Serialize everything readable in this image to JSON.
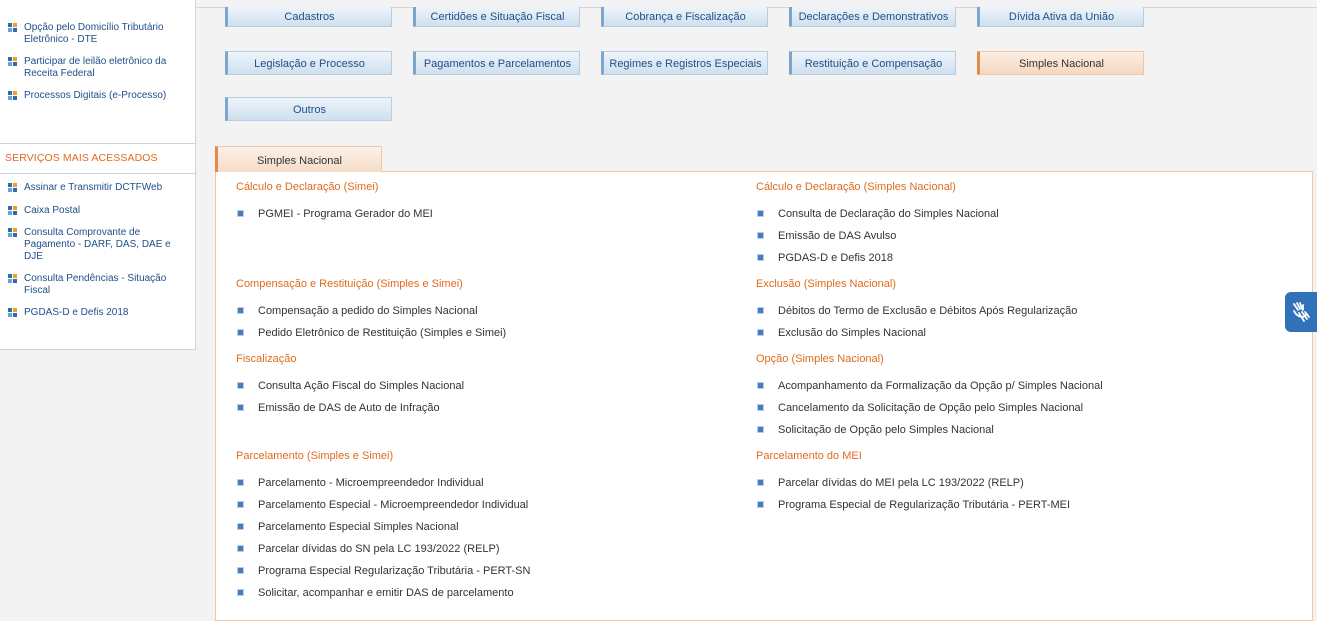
{
  "sidebar": {
    "top_items": [
      {
        "label": "Opção pelo Domicílio Tributário Eletrônico - DTE"
      },
      {
        "label": "Participar de leilão eletrônico da Receita Federal"
      },
      {
        "label": "Processos Digitais (e-Processo)"
      }
    ],
    "section_title": "SERVIÇOS MAIS ACESSADOS",
    "items": [
      {
        "label": "Assinar e Transmitir DCTFWeb"
      },
      {
        "label": "Caixa Postal"
      },
      {
        "label": "Consulta Comprovante de Pagamento - DARF, DAS, DAE e DJE"
      },
      {
        "label": "Consulta Pendências - Situação Fiscal"
      },
      {
        "label": "PGDAS-D e Defis 2018"
      }
    ]
  },
  "categories": [
    {
      "label": "Cadastros"
    },
    {
      "label": "Certidões e Situação Fiscal"
    },
    {
      "label": "Cobrança e Fiscalização"
    },
    {
      "label": "Declarações e Demonstrativos"
    },
    {
      "label": "Dívida Ativa da União"
    },
    {
      "label": "Legislação e Processo"
    },
    {
      "label": "Pagamentos e Parcelamentos"
    },
    {
      "label": "Regimes e Registros Especiais"
    },
    {
      "label": "Restituição e Compensação"
    },
    {
      "label": "Simples Nacional"
    },
    {
      "label": "Outros"
    }
  ],
  "tab": {
    "label": "Simples Nacional"
  },
  "groups": {
    "g1": {
      "title": "Cálculo e Declaração (Simei)",
      "links": [
        "PGMEI - Programa Gerador do MEI"
      ]
    },
    "g2": {
      "title": "Cálculo e Declaração (Simples Nacional)",
      "links": [
        "Consulta de Declaração do Simples Nacional",
        "Emissão de DAS Avulso",
        "PGDAS-D e Defis 2018"
      ]
    },
    "g3": {
      "title": "Compensação e Restituição (Simples e Simei)",
      "links": [
        "Compensação a pedido do Simples Nacional",
        "Pedido Eletrônico de Restituição (Simples e Simei)"
      ]
    },
    "g4": {
      "title": "Exclusão (Simples Nacional)",
      "links": [
        "Débitos do Termo de Exclusão e Débitos Após Regularização",
        "Exclusão do Simples Nacional"
      ]
    },
    "g5": {
      "title": "Fiscalização",
      "links": [
        "Consulta Ação Fiscal do Simples Nacional",
        "Emissão de DAS de Auto de Infração"
      ]
    },
    "g6": {
      "title": "Opção (Simples Nacional)",
      "links": [
        "Acompanhamento da Formalização da Opção p/ Simples Nacional",
        "Cancelamento da Solicitação de Opção pelo Simples Nacional",
        "Solicitação de Opção pelo Simples Nacional"
      ]
    },
    "g7": {
      "title": "Parcelamento (Simples e Simei)",
      "links": [
        "Parcelamento - Microempreendedor Individual",
        "Parcelamento Especial - Microempreendedor Individual",
        "Parcelamento Especial Simples Nacional",
        "Parcelar dívidas do SN pela LC 193/2022 (RELP)",
        "Programa Especial Regularização Tributária - PERT-SN",
        "Solicitar, acompanhar e emitir DAS de parcelamento"
      ]
    },
    "g8": {
      "title": "Parcelamento do MEI",
      "links": [
        "Parcelar dívidas do MEI pela LC 193/2022 (RELP)",
        "Programa Especial de Regularização Tributária - PERT-MEI"
      ]
    }
  },
  "accessibility": {
    "icon": "sign-language-icon",
    "color": "#2f72b9"
  }
}
